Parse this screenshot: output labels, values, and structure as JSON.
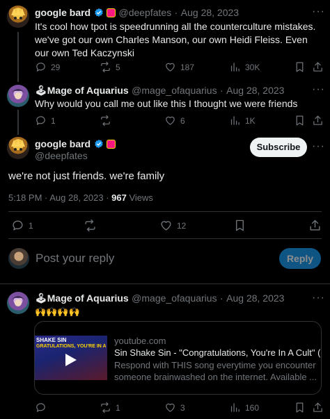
{
  "tweet1": {
    "display_name": "google bard",
    "handle": "@deepfates",
    "date": "Aug 28, 2023",
    "text": "It's cool how tpot is speedrunning all the counterculture mistakes. we've got our own Charles Manson, our own Heidi Fleiss. Even our own Ted Kaczynski",
    "replies": "29",
    "retweets": "5",
    "likes": "187",
    "views": "30K"
  },
  "tweet2": {
    "display_name": "🕹Mage of Aquarius",
    "handle": "@mage_ofaquarius",
    "date": "Aug 28, 2023",
    "text": "Why would you call me out like this I thought we were friends",
    "replies": "1",
    "retweets": "",
    "likes": "6",
    "views": "1K"
  },
  "main_tweet": {
    "display_name": "google bard",
    "handle": "@deepfates",
    "subscribe_label": "Subscribe",
    "text": "we're not just friends. we're family",
    "time": "5:18 PM · Aug 28, 2023 · ",
    "views_count": "967",
    "views_label": "Views",
    "replies": "1",
    "retweets": "",
    "likes": "12"
  },
  "reply_box": {
    "placeholder": "Post your reply",
    "button_label": "Reply"
  },
  "tweet3": {
    "display_name": "🕹Mage of Aquarius",
    "handle": "@mage_ofaquarius",
    "date": "Aug 28, 2023",
    "text": "🙌🙌🙌🙌",
    "card": {
      "domain": "youtube.com",
      "title": "Sin Shake Sin - \"Congratulations, You're In A Cult\" (O",
      "description": "Respond with THIS song everytime you encounter someone brainwashed on the internet. Available ...",
      "thumb_text1": "SHAKE SIN",
      "thumb_text2": "GRATULATIONS, YOU'RE IN A C"
    },
    "replies": "",
    "retweets": "1",
    "likes": "3",
    "views": "160"
  },
  "colors": {
    "background": "#000000",
    "text": "#e7e9ea",
    "muted": "#71767b",
    "accent": "#1d9bf0",
    "divider": "#2f3336"
  },
  "icons": [
    "reply-icon",
    "retweet-icon",
    "like-icon",
    "views-icon",
    "bookmark-icon",
    "share-icon",
    "more-icon",
    "verified-icon",
    "play-icon"
  ]
}
